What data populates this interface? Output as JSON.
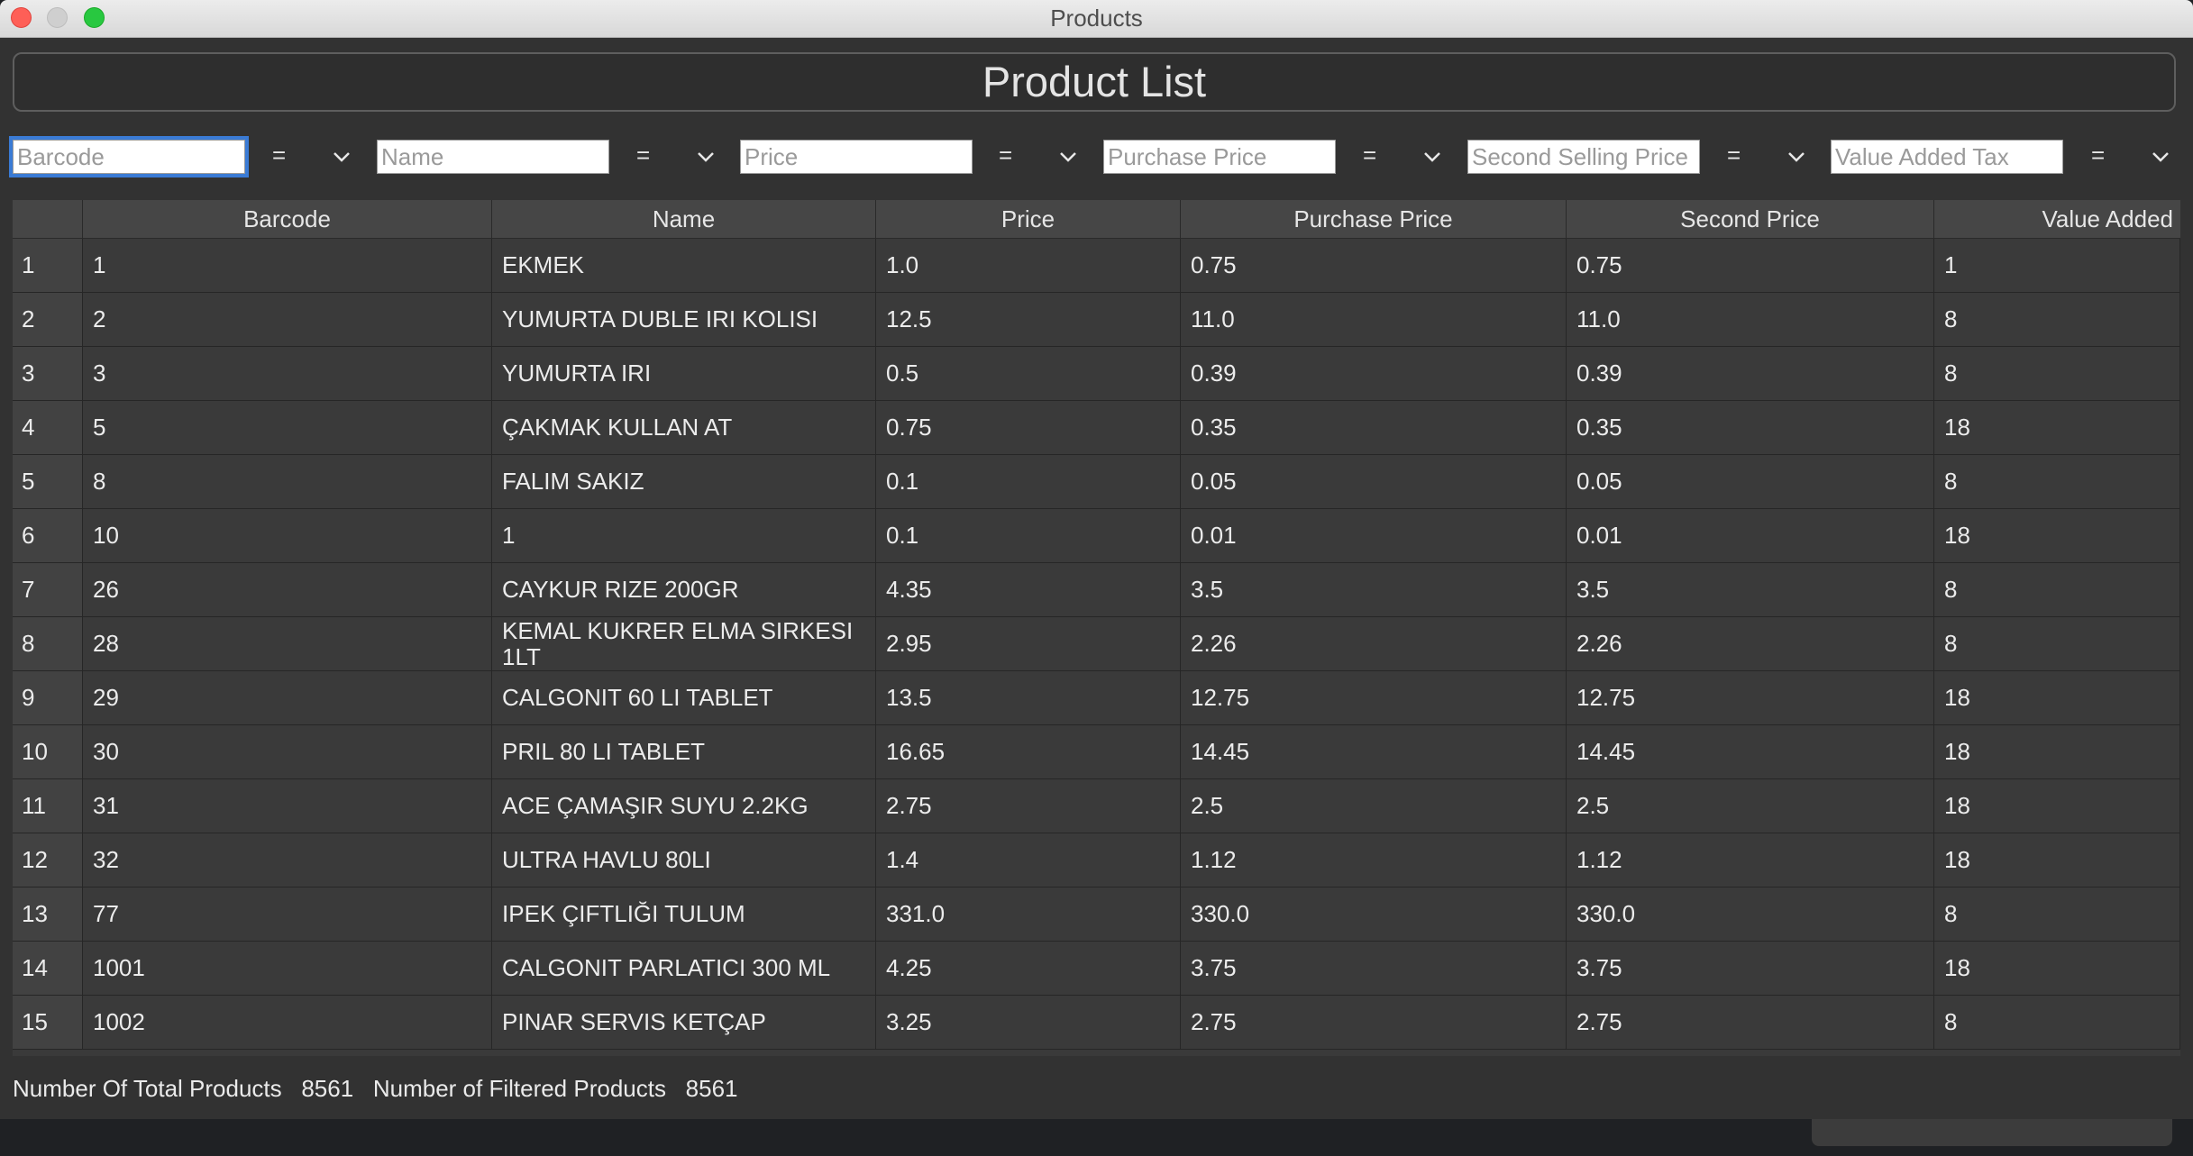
{
  "window": {
    "title": "Products"
  },
  "header": {
    "title": "Product List"
  },
  "filters": [
    {
      "placeholder": "Barcode",
      "operator": "="
    },
    {
      "placeholder": "Name",
      "operator": "="
    },
    {
      "placeholder": "Price",
      "operator": "="
    },
    {
      "placeholder": "Purchase Price",
      "operator": "="
    },
    {
      "placeholder": "Second Selling Price",
      "operator": "="
    },
    {
      "placeholder": "Value Added Tax",
      "operator": "="
    }
  ],
  "table": {
    "columns": [
      "Barcode",
      "Name",
      "Price",
      "Purchase Price",
      "Second Price",
      "Value Added"
    ],
    "rows": [
      {
        "num": "1",
        "barcode": "1",
        "name": "EKMEK",
        "price": "1.0",
        "purchase": "0.75",
        "second": "0.75",
        "vat": "1"
      },
      {
        "num": "2",
        "barcode": "2",
        "name": "YUMURTA DUBLE IRI KOLISI",
        "price": "12.5",
        "purchase": "11.0",
        "second": "11.0",
        "vat": "8"
      },
      {
        "num": "3",
        "barcode": "3",
        "name": "YUMURTA IRI",
        "price": "0.5",
        "purchase": "0.39",
        "second": "0.39",
        "vat": "8"
      },
      {
        "num": "4",
        "barcode": "5",
        "name": "ÇAKMAK KULLAN AT",
        "price": "0.75",
        "purchase": "0.35",
        "second": "0.35",
        "vat": "18"
      },
      {
        "num": "5",
        "barcode": "8",
        "name": "FALIM SAKIZ",
        "price": "0.1",
        "purchase": "0.05",
        "second": "0.05",
        "vat": "8"
      },
      {
        "num": "6",
        "barcode": "10",
        "name": "1",
        "price": "0.1",
        "purchase": "0.01",
        "second": "0.01",
        "vat": "18"
      },
      {
        "num": "7",
        "barcode": "26",
        "name": "CAYKUR RIZE 200GR",
        "price": "4.35",
        "purchase": "3.5",
        "second": "3.5",
        "vat": "8"
      },
      {
        "num": "8",
        "barcode": "28",
        "name": "KEMAL KUKRER ELMA SIRKESI 1LT",
        "price": "2.95",
        "purchase": "2.26",
        "second": "2.26",
        "vat": "8"
      },
      {
        "num": "9",
        "barcode": "29",
        "name": "CALGONIT 60 LI TABLET",
        "price": "13.5",
        "purchase": "12.75",
        "second": "12.75",
        "vat": "18"
      },
      {
        "num": "10",
        "barcode": "30",
        "name": "PRIL 80 LI TABLET",
        "price": "16.65",
        "purchase": "14.45",
        "second": "14.45",
        "vat": "18"
      },
      {
        "num": "11",
        "barcode": "31",
        "name": "ACE ÇAMAŞIR SUYU 2.2KG",
        "price": "2.75",
        "purchase": "2.5",
        "second": "2.5",
        "vat": "18"
      },
      {
        "num": "12",
        "barcode": "32",
        "name": "ULTRA HAVLU 80LI",
        "price": "1.4",
        "purchase": "1.12",
        "second": "1.12",
        "vat": "18"
      },
      {
        "num": "13",
        "barcode": "77",
        "name": "IPEK ÇIFTLIĞI TULUM",
        "price": "331.0",
        "purchase": "330.0",
        "second": "330.0",
        "vat": "8"
      },
      {
        "num": "14",
        "barcode": "1001",
        "name": "CALGONIT PARLATICI 300 ML",
        "price": "4.25",
        "purchase": "3.75",
        "second": "3.75",
        "vat": "18"
      },
      {
        "num": "15",
        "barcode": "1002",
        "name": "PINAR SERVIS KETÇAP",
        "price": "3.25",
        "purchase": "2.75",
        "second": "2.75",
        "vat": "8"
      }
    ]
  },
  "status": {
    "total_label": "Number Of Total Products",
    "total_value": "8561",
    "filtered_label": "Number of Filtered Products",
    "filtered_value": "8561"
  },
  "icons": {
    "close": "close-icon",
    "minimize": "minimize-icon",
    "maximize": "maximize-icon",
    "dropdown": "chevron-down-icon"
  },
  "colors": {
    "accent": "#3a7bd5",
    "close": "#fe5f57",
    "maximize": "#28c840"
  }
}
